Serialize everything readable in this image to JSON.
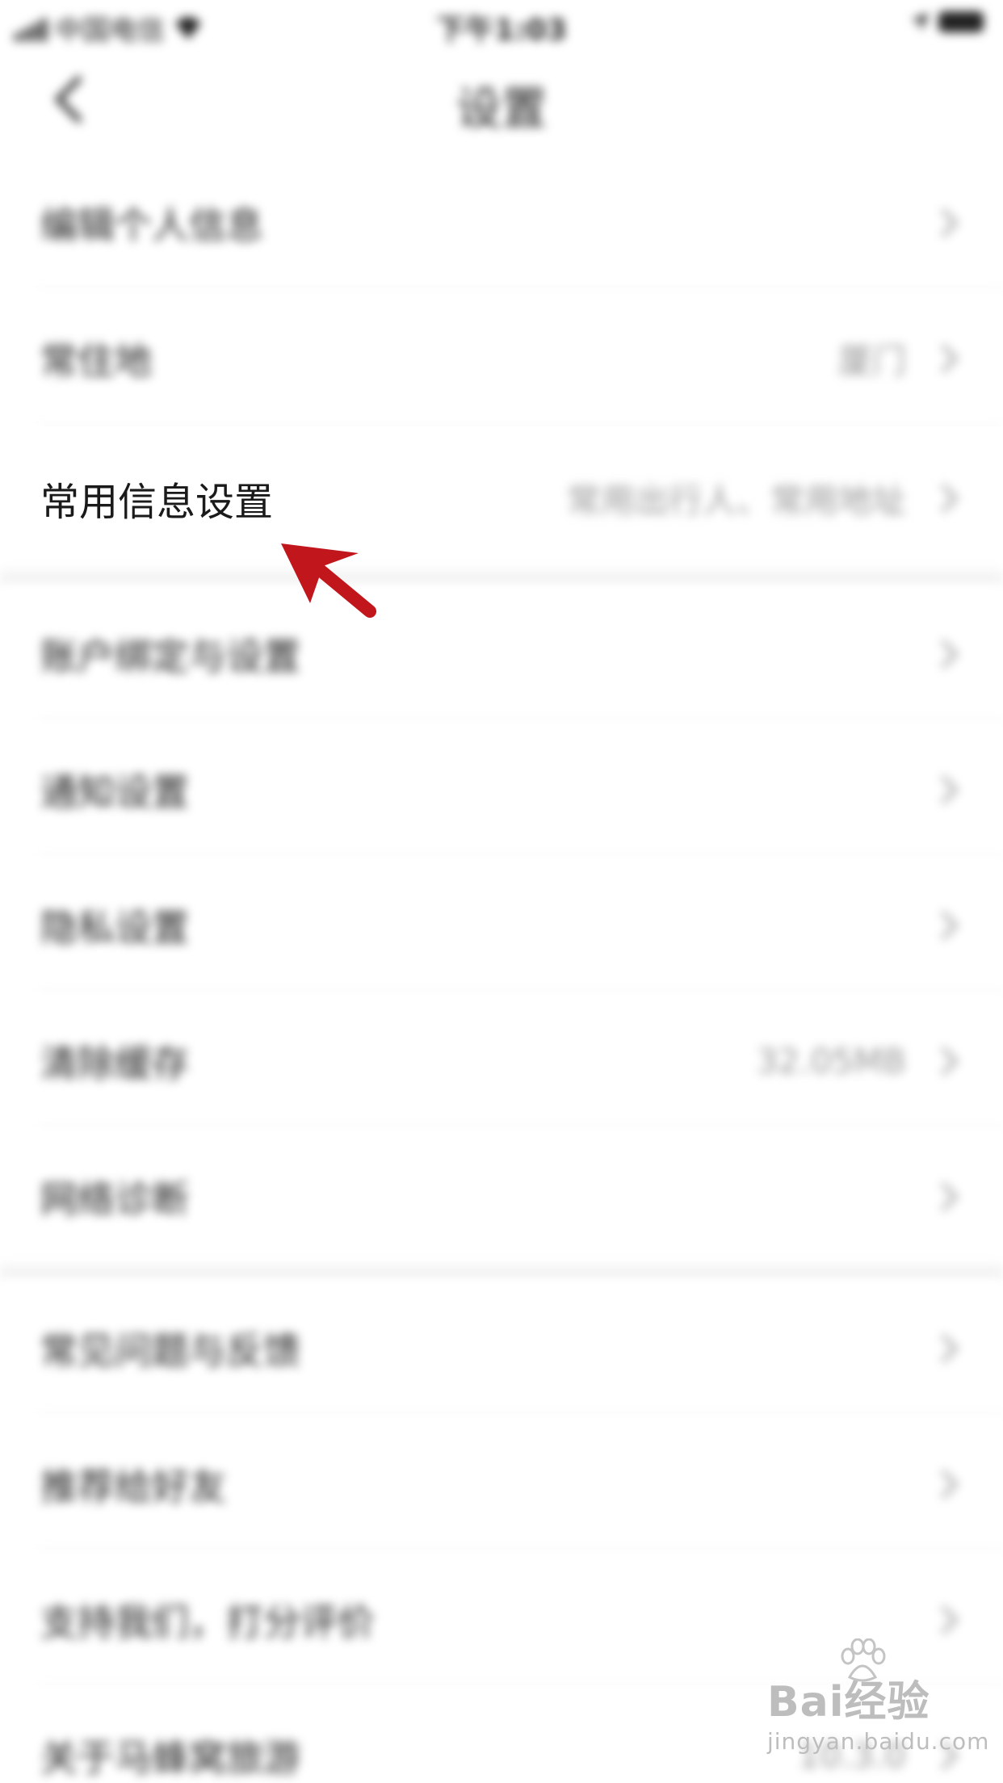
{
  "status_bar": {
    "carrier": "中国电信",
    "time": "下午1:03"
  },
  "nav": {
    "title": "设置"
  },
  "groups": [
    {
      "items": [
        {
          "label": "编辑个人信息",
          "value": ""
        },
        {
          "label": "常住地",
          "value": "厦门"
        },
        {
          "label": "常用信息设置",
          "value": "常用出行人、常用地址"
        }
      ]
    },
    {
      "items": [
        {
          "label": "账户绑定与设置",
          "value": ""
        },
        {
          "label": "通知设置",
          "value": ""
        },
        {
          "label": "隐私设置",
          "value": ""
        },
        {
          "label": "清除缓存",
          "value": "32.05MB"
        },
        {
          "label": "网络诊断",
          "value": ""
        }
      ]
    },
    {
      "items": [
        {
          "label": "常见问题与反馈",
          "value": ""
        },
        {
          "label": "推荐给好友",
          "value": ""
        },
        {
          "label": "支持我们，打分评价",
          "value": ""
        },
        {
          "label": "关于马蜂窝旅游",
          "value": "10.3.0"
        }
      ]
    }
  ],
  "watermark": {
    "logo": "Bai经验",
    "url": "jingyan.baidu.com"
  },
  "colors": {
    "annotation_arrow": "#c0161c",
    "chevron": "#b8b8b8",
    "value_text": "#999999"
  }
}
